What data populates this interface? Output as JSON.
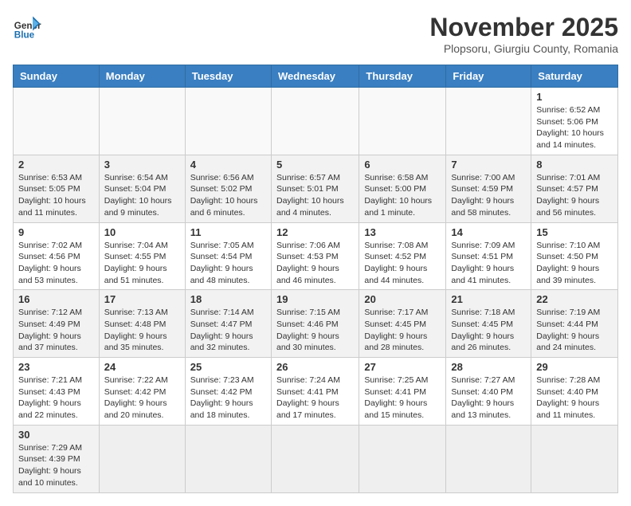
{
  "header": {
    "logo_general": "General",
    "logo_blue": "Blue",
    "month_title": "November 2025",
    "subtitle": "Plopsoru, Giurgiu County, Romania"
  },
  "weekdays": [
    "Sunday",
    "Monday",
    "Tuesday",
    "Wednesday",
    "Thursday",
    "Friday",
    "Saturday"
  ],
  "weeks": [
    [
      {
        "day": "",
        "info": ""
      },
      {
        "day": "",
        "info": ""
      },
      {
        "day": "",
        "info": ""
      },
      {
        "day": "",
        "info": ""
      },
      {
        "day": "",
        "info": ""
      },
      {
        "day": "",
        "info": ""
      },
      {
        "day": "1",
        "info": "Sunrise: 6:52 AM\nSunset: 5:06 PM\nDaylight: 10 hours and 14 minutes."
      }
    ],
    [
      {
        "day": "2",
        "info": "Sunrise: 6:53 AM\nSunset: 5:05 PM\nDaylight: 10 hours and 11 minutes."
      },
      {
        "day": "3",
        "info": "Sunrise: 6:54 AM\nSunset: 5:04 PM\nDaylight: 10 hours and 9 minutes."
      },
      {
        "day": "4",
        "info": "Sunrise: 6:56 AM\nSunset: 5:02 PM\nDaylight: 10 hours and 6 minutes."
      },
      {
        "day": "5",
        "info": "Sunrise: 6:57 AM\nSunset: 5:01 PM\nDaylight: 10 hours and 4 minutes."
      },
      {
        "day": "6",
        "info": "Sunrise: 6:58 AM\nSunset: 5:00 PM\nDaylight: 10 hours and 1 minute."
      },
      {
        "day": "7",
        "info": "Sunrise: 7:00 AM\nSunset: 4:59 PM\nDaylight: 9 hours and 58 minutes."
      },
      {
        "day": "8",
        "info": "Sunrise: 7:01 AM\nSunset: 4:57 PM\nDaylight: 9 hours and 56 minutes."
      }
    ],
    [
      {
        "day": "9",
        "info": "Sunrise: 7:02 AM\nSunset: 4:56 PM\nDaylight: 9 hours and 53 minutes."
      },
      {
        "day": "10",
        "info": "Sunrise: 7:04 AM\nSunset: 4:55 PM\nDaylight: 9 hours and 51 minutes."
      },
      {
        "day": "11",
        "info": "Sunrise: 7:05 AM\nSunset: 4:54 PM\nDaylight: 9 hours and 48 minutes."
      },
      {
        "day": "12",
        "info": "Sunrise: 7:06 AM\nSunset: 4:53 PM\nDaylight: 9 hours and 46 minutes."
      },
      {
        "day": "13",
        "info": "Sunrise: 7:08 AM\nSunset: 4:52 PM\nDaylight: 9 hours and 44 minutes."
      },
      {
        "day": "14",
        "info": "Sunrise: 7:09 AM\nSunset: 4:51 PM\nDaylight: 9 hours and 41 minutes."
      },
      {
        "day": "15",
        "info": "Sunrise: 7:10 AM\nSunset: 4:50 PM\nDaylight: 9 hours and 39 minutes."
      }
    ],
    [
      {
        "day": "16",
        "info": "Sunrise: 7:12 AM\nSunset: 4:49 PM\nDaylight: 9 hours and 37 minutes."
      },
      {
        "day": "17",
        "info": "Sunrise: 7:13 AM\nSunset: 4:48 PM\nDaylight: 9 hours and 35 minutes."
      },
      {
        "day": "18",
        "info": "Sunrise: 7:14 AM\nSunset: 4:47 PM\nDaylight: 9 hours and 32 minutes."
      },
      {
        "day": "19",
        "info": "Sunrise: 7:15 AM\nSunset: 4:46 PM\nDaylight: 9 hours and 30 minutes."
      },
      {
        "day": "20",
        "info": "Sunrise: 7:17 AM\nSunset: 4:45 PM\nDaylight: 9 hours and 28 minutes."
      },
      {
        "day": "21",
        "info": "Sunrise: 7:18 AM\nSunset: 4:45 PM\nDaylight: 9 hours and 26 minutes."
      },
      {
        "day": "22",
        "info": "Sunrise: 7:19 AM\nSunset: 4:44 PM\nDaylight: 9 hours and 24 minutes."
      }
    ],
    [
      {
        "day": "23",
        "info": "Sunrise: 7:21 AM\nSunset: 4:43 PM\nDaylight: 9 hours and 22 minutes."
      },
      {
        "day": "24",
        "info": "Sunrise: 7:22 AM\nSunset: 4:42 PM\nDaylight: 9 hours and 20 minutes."
      },
      {
        "day": "25",
        "info": "Sunrise: 7:23 AM\nSunset: 4:42 PM\nDaylight: 9 hours and 18 minutes."
      },
      {
        "day": "26",
        "info": "Sunrise: 7:24 AM\nSunset: 4:41 PM\nDaylight: 9 hours and 17 minutes."
      },
      {
        "day": "27",
        "info": "Sunrise: 7:25 AM\nSunset: 4:41 PM\nDaylight: 9 hours and 15 minutes."
      },
      {
        "day": "28",
        "info": "Sunrise: 7:27 AM\nSunset: 4:40 PM\nDaylight: 9 hours and 13 minutes."
      },
      {
        "day": "29",
        "info": "Sunrise: 7:28 AM\nSunset: 4:40 PM\nDaylight: 9 hours and 11 minutes."
      }
    ],
    [
      {
        "day": "30",
        "info": "Sunrise: 7:29 AM\nSunset: 4:39 PM\nDaylight: 9 hours and 10 minutes."
      },
      {
        "day": "",
        "info": ""
      },
      {
        "day": "",
        "info": ""
      },
      {
        "day": "",
        "info": ""
      },
      {
        "day": "",
        "info": ""
      },
      {
        "day": "",
        "info": ""
      },
      {
        "day": "",
        "info": ""
      }
    ]
  ]
}
